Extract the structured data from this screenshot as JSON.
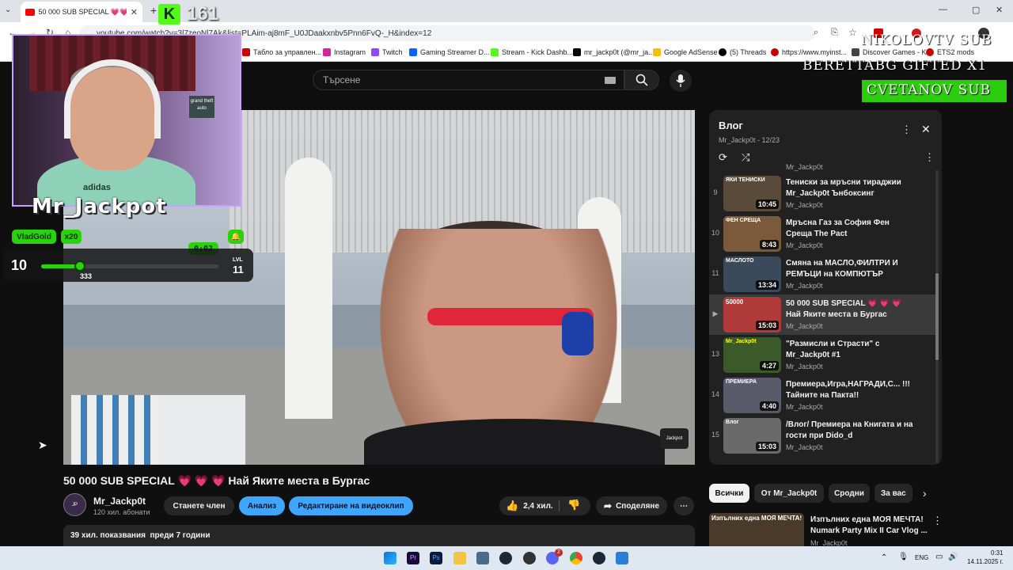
{
  "browser": {
    "tab_title": "50 000 SUB SPECIAL 💗💗(🔊",
    "url": "youtube.com/watch?v=3l7zeoNl7Ak&list=PLAim-aj8mF_U0JDaakxnbv5Pnn6FvQ-_H&index=12",
    "bookmarks": [
      {
        "label": "Табло за управлен...",
        "color": "#c00"
      },
      {
        "label": "Instagram",
        "color": "#d6249f"
      },
      {
        "label": "Twitch",
        "color": "#9146ff"
      },
      {
        "label": "Gaming Streamer D...",
        "color": "#0866ff"
      },
      {
        "label": "Stream - Kick Dashb...",
        "color": "#1b1b1b"
      },
      {
        "label": "mr_jackp0t (@mr_ja...",
        "color": "#000"
      },
      {
        "label": "Google AdSense",
        "color": "#fbbc04"
      },
      {
        "label": "(5) Threads",
        "color": "#000"
      },
      {
        "label": "https://www.myinst...",
        "color": "#c00"
      },
      {
        "label": "Discover Games - K...",
        "color": "#444"
      },
      {
        "label": "ETS2 mods",
        "color": "#c00"
      }
    ]
  },
  "overlay": {
    "kick_count": "161",
    "alert_line1": "NIKOLOVTV SUB",
    "alert_line2": "BERETTABG GIFTED X1",
    "alert_line3": "CVETANOV SUB",
    "streamer_name": "Mr_Jackpot",
    "shirt_brand": "adidas",
    "gifter": "VladGold",
    "multiplier": "x20",
    "timer": "0:02",
    "level_current": "10",
    "xp_value": "333",
    "xp_progress": 0.22,
    "level_label": "LVL",
    "level_next": "11",
    "watermark": "Jackpot"
  },
  "youtube": {
    "search_placeholder": "Търсене",
    "video_title": "50 000 SUB SPECIAL 💗 💗 💗 Най Яките места в Бургас",
    "channel_name": "Mr_Jackp0t",
    "subscribers": "120 хил. абонати",
    "join_label": "Станете член",
    "analyze_label": "Анализ",
    "edit_label": "Редактиране на видеоклип",
    "likes": "2,4 хил.",
    "share_label": "Споделяне",
    "views_line": "39 хил. показвания  преди 7 години",
    "chips": [
      "Всички",
      "От Mr_Jackp0t",
      "Сродни",
      "За вас"
    ],
    "recommended": {
      "title": "Изпълних една МОЯ МЕЧТА! Numark Party Mix II Car Vlog ...",
      "channel": "Mr_Jackp0t",
      "thumb_text": "Изпълних една МОЯ МЕЧТА!"
    },
    "playlist": {
      "title": "Влог",
      "subtitle": "Mr_Jackp0t - 12/23",
      "top_channel": "Mr_Jackp0t",
      "items": [
        {
          "num": "9",
          "title": "Тениски за мръсни тираджии Mr_Jackp0t Ънбоксинг",
          "channel": "Mr_Jackp0t",
          "duration": "10:45",
          "thumb_color": "#5a4a3a",
          "thumb_text": "ЯКИ ТЕНИСКИ"
        },
        {
          "num": "10",
          "title": "Мръсна Газ за София Фен Среща The Pact",
          "channel": "Mr_Jackp0t",
          "duration": "8:43",
          "thumb_color": "#7a5a3a",
          "thumb_text": "ФЕН СРЕЩА"
        },
        {
          "num": "11",
          "title": "Смяна на МАСЛО,ФИЛТРИ И РЕМЪЦИ на КОМПЮТЪР",
          "channel": "Mr_Jackp0t",
          "duration": "13:34",
          "thumb_color": "#3a4a5a",
          "thumb_text": "МАСЛОТО"
        },
        {
          "num": "▶",
          "title": "50 000 SUB SPECIAL 💗 💗 💗 Най Яките места в Бургас",
          "channel": "Mr_Jackp0t",
          "duration": "15:03",
          "thumb_color": "#b03a3a",
          "thumb_text": "50000"
        },
        {
          "num": "13",
          "title": "\"Размисли и Страсти\" с Mr_Jackp0t #1",
          "channel": "Mr_Jackp0t",
          "duration": "4:27",
          "thumb_color": "#3a5a2a",
          "thumb_text": "Mr_Jackp0t"
        },
        {
          "num": "14",
          "title": "Премиера,Игра,НАГРАДИ,С... !!! Тайните на Пакта!!",
          "channel": "Mr_Jackp0t",
          "duration": "4:40",
          "thumb_color": "#5a5a6a",
          "thumb_text": "ПРЕМИЕРА"
        },
        {
          "num": "15",
          "title": "/Влог/ Премиера на Книгата и на гости при Dido_d",
          "channel": "Mr_Jackp0t",
          "duration": "15:03",
          "thumb_color": "#6a6a6a",
          "thumb_text": "Влог"
        }
      ]
    }
  },
  "taskbar": {
    "lang": "ENG",
    "time": "0:31",
    "date": "14.11.2025 г.",
    "discord_badge": "2"
  }
}
